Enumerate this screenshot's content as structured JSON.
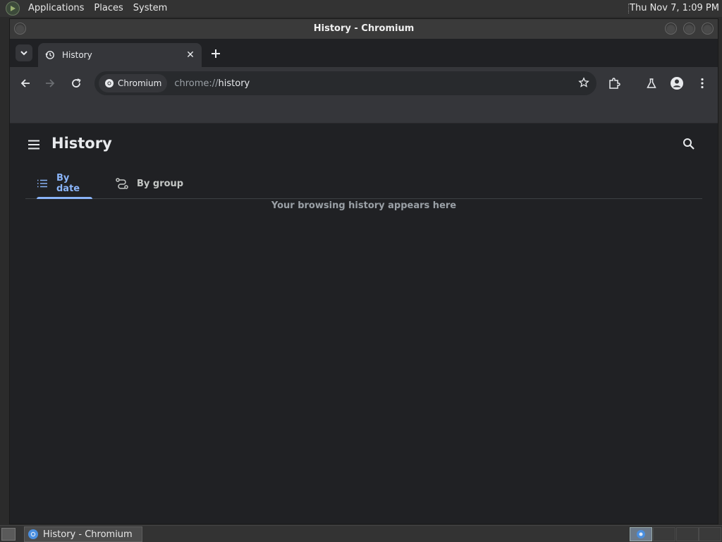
{
  "top_panel": {
    "menus": [
      "Applications",
      "Places",
      "System"
    ],
    "clock": "Thu Nov 7, 1:09 PM"
  },
  "window": {
    "title": "History - Chromium"
  },
  "browser": {
    "tab": {
      "title": "History",
      "icon": "history-icon"
    },
    "omnibox": {
      "chip_label": "Chromium",
      "url_scheme": "chrome://",
      "url_path": "history"
    }
  },
  "page": {
    "title": "History",
    "tabs": [
      {
        "label": "By date",
        "icon": "list-icon",
        "selected": true
      },
      {
        "label": "By group",
        "icon": "group-icon",
        "selected": false
      }
    ],
    "empty_message": "Your browsing history appears here"
  },
  "taskbar": {
    "task_label": "History - Chromium"
  },
  "colors": {
    "accent": "#8ab4f8",
    "page_bg": "#202124",
    "toolbar_bg": "#35363a"
  }
}
